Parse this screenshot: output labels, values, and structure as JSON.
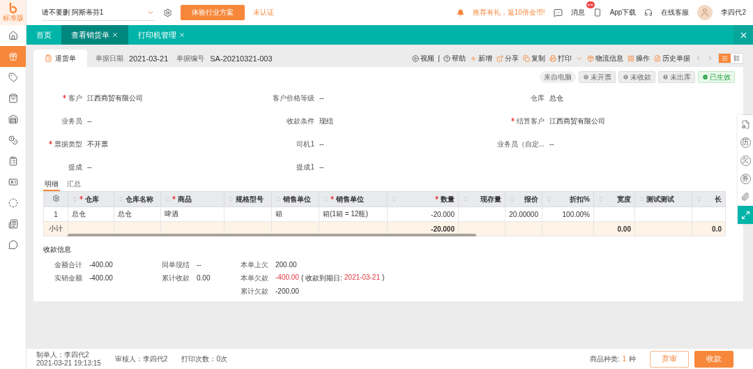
{
  "sidebar": {
    "logo": "标准版",
    "items": [
      {
        "selected": false
      },
      {
        "selected": true
      },
      {
        "selected": false
      },
      {
        "selected": false
      },
      {
        "selected": false
      },
      {
        "selected": false
      },
      {
        "selected": false
      },
      {
        "selected": false
      },
      {
        "selected": false
      },
      {
        "selected": false
      },
      {
        "selected": false
      }
    ]
  },
  "top_bar": {
    "company_select": "请不要删 阿斯蒂芬1",
    "industry_button": "体验行业方案",
    "certification": "未认证",
    "promo": "推荐有礼，返10倍金币!",
    "messages": "消息",
    "app_download": "App下载",
    "support": "在线客服",
    "user": "李四代2"
  },
  "tabs": [
    {
      "label": "首页",
      "selected": false,
      "closable": false
    },
    {
      "label": "查看销货单",
      "selected": true,
      "closable": true
    },
    {
      "label": "打印机管理",
      "selected": false,
      "closable": true
    }
  ],
  "doc_header": {
    "doc_tab": "退货单",
    "fields": [
      {
        "label": "单据日期",
        "value": "2021-03-21"
      },
      {
        "label": "单据编号",
        "value": "SA-20210321-003"
      }
    ]
  },
  "toolbar": [
    {
      "label": "视频",
      "kind": "video",
      "menu": false
    },
    {
      "label": "帮助",
      "kind": "help",
      "menu": false
    },
    {
      "label": "新增",
      "kind": "add",
      "menu": false
    },
    {
      "label": "分享",
      "kind": "share",
      "menu": false
    },
    {
      "label": "复制",
      "kind": "copy",
      "menu": false
    },
    {
      "label": "打印",
      "kind": "print",
      "menu": true
    },
    {
      "label": "物流信息",
      "kind": "logistics",
      "menu": false
    },
    {
      "label": "操作",
      "kind": "operate",
      "menu": false
    },
    {
      "label": "历史单据",
      "kind": "history",
      "menu": false
    }
  ],
  "view_toggle": [
    {
      "selected": true
    },
    {
      "selected": false
    }
  ],
  "status_badges": [
    {
      "label": "来自电脑",
      "kind": "source"
    },
    {
      "label": "未开票",
      "kind": "pending"
    },
    {
      "label": "未收款",
      "kind": "pending"
    },
    {
      "label": "未出库",
      "kind": "pending"
    },
    {
      "label": "已生效",
      "kind": "done"
    }
  ],
  "form_rows": [
    [
      {
        "label": "客户",
        "value": "江西商贸有限公司",
        "required": true
      },
      {
        "label": "客户价格等级",
        "value": "--",
        "required": false
      },
      {
        "label": "仓库",
        "value": "总仓",
        "required": false
      }
    ],
    [
      {
        "label": "业务员",
        "value": "--",
        "required": false
      },
      {
        "label": "收款条件",
        "value": "现结",
        "required": false
      },
      {
        "label": "结算客户",
        "value": "江西商贸有限公司",
        "required": true
      }
    ],
    [
      {
        "label": "票据类型",
        "value": "不开票",
        "required": true
      },
      {
        "label": "司机1",
        "value": "--",
        "required": false
      },
      {
        "label": "业务员（自定...",
        "value": "--",
        "required": false
      }
    ],
    [
      {
        "label": "提成",
        "value": "--",
        "required": false
      },
      {
        "label": "提成1",
        "value": "--",
        "required": false
      }
    ]
  ],
  "detail_tabs": [
    {
      "label": "明细",
      "selected": true
    },
    {
      "label": "汇总",
      "selected": false
    }
  ],
  "table": {
    "columns": [
      {
        "label": "仓库",
        "required": true
      },
      {
        "label": "仓库名称",
        "required": false
      },
      {
        "label": "商品",
        "required": true
      },
      {
        "label": "规格型号",
        "required": false
      },
      {
        "label": "销售单位",
        "required": false
      },
      {
        "label": "销售单位",
        "required": true
      },
      {
        "label": "数量",
        "required": true
      },
      {
        "label": "现存量",
        "required": false
      },
      {
        "label": "报价",
        "required": false
      },
      {
        "label": "折扣%",
        "required": false
      },
      {
        "label": "宽度",
        "required": false
      },
      {
        "label": "测试测试",
        "required": false
      },
      {
        "label": "长",
        "required": false
      }
    ],
    "rows": [
      {
        "index": "1",
        "cells": [
          "总仓",
          "总仓",
          "啤酒",
          null,
          "箱",
          "箱(1箱 = 12瓶)",
          "-20.000",
          null,
          "20.00000",
          "100.00%",
          null,
          null,
          null
        ]
      }
    ],
    "subtotal": {
      "label": "小计",
      "cells": [
        null,
        null,
        null,
        null,
        null,
        null,
        "-20.000",
        null,
        null,
        null,
        "0.00",
        null,
        "0.0"
      ]
    }
  },
  "payment_info": {
    "title": "收款信息",
    "columns": [
      [
        {
          "label": "金额合计",
          "value": "-400.00",
          "highlight": false
        },
        {
          "label": "实销金额",
          "value": "-400.00",
          "highlight": false
        }
      ],
      [
        {
          "label": "同单现结",
          "value": "--",
          "highlight": false
        },
        {
          "label": "累计收款",
          "value": "0.00",
          "highlight": false
        }
      ],
      [
        {
          "label": "本单上欠",
          "value": "200.00",
          "highlight": false
        },
        {
          "label": "本单欠款",
          "value": "-400.00",
          "highlight": true,
          "due": {
            "prefix": "( 收款到期日:",
            "date": "2021-03-21",
            "suffix": ")"
          }
        },
        {
          "label": "累计欠款",
          "value": "-200.00",
          "highlight": false
        }
      ]
    ]
  },
  "right_panel": [
    {
      "kind": "note",
      "selected": false
    },
    {
      "kind": "glyph",
      "label": "历",
      "selected": false
    },
    {
      "kind": "glyph",
      "label": "欠",
      "selected": false
    },
    {
      "kind": "glyph",
      "label": "券",
      "selected": false
    },
    {
      "kind": "attach",
      "selected": false
    },
    {
      "kind": "expand",
      "selected": true
    }
  ],
  "footer": {
    "creator": "制单人：李四代2",
    "created_at": "2021-03-21 19:13:15",
    "auditor": "审核人：李四代2",
    "print_count": "打印次数：0次",
    "product_kinds_label": "商品种类:",
    "product_kinds_count": "1",
    "product_kinds_unit": "种",
    "buttons": [
      {
        "label": "弃审",
        "kind": "outline"
      },
      {
        "label": "收款",
        "kind": "primary"
      }
    ]
  }
}
